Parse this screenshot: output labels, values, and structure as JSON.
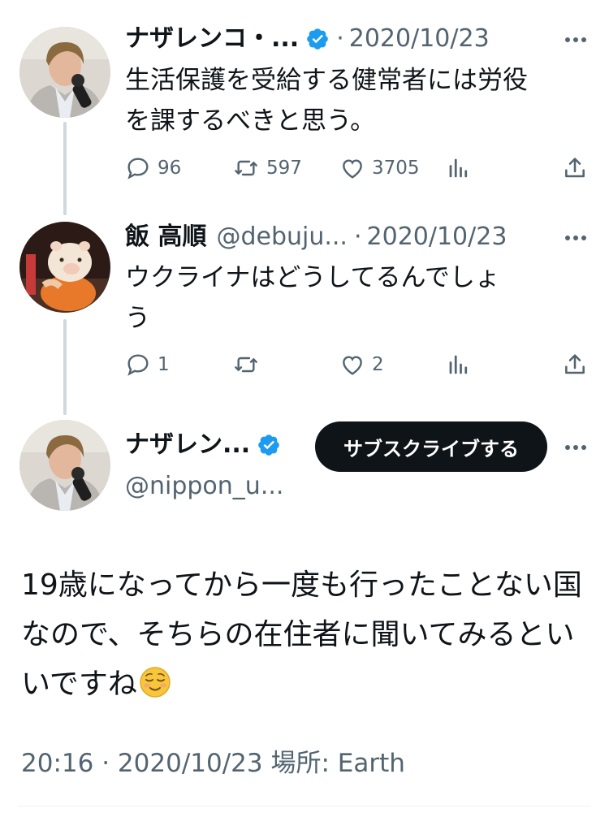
{
  "tweets": [
    {
      "name": "ナザレンコ・...",
      "separator": "·",
      "date": "2020/10/23",
      "text": "生活保護を受給する健常者には労役\nを課するべきと思う。",
      "replies": "96",
      "retweets": "597",
      "likes": "3705"
    },
    {
      "name": "飯 高順",
      "handle": "@debuju...",
      "separator": "·",
      "date": "2020/10/23",
      "text": "ウクライナはどうしてるんでしょ\nう",
      "replies": "1",
      "retweets": "",
      "likes": "2"
    }
  ],
  "main_tweet": {
    "name": "ナザレン...",
    "handle": "@nippon_u...",
    "subscribe_label": "サブスクライブする",
    "text": "19歳になってから一度も行ったことない国なので、そちらの在住者に聞いてみるといいですね",
    "emoji": "relieved-face-emoji",
    "time": "20:16",
    "separator": "·",
    "date": "2020/10/23",
    "location_label": "場所:",
    "location": "Earth"
  },
  "colors": {
    "text": "#0f1419",
    "muted": "#536471",
    "verified": "#1d9bf0",
    "thread_line": "#cfd9de",
    "button_bg": "#0f1419"
  },
  "icons": [
    "reply-icon",
    "retweet-icon",
    "like-icon",
    "views-icon",
    "share-icon",
    "verified-icon",
    "more-icon"
  ]
}
